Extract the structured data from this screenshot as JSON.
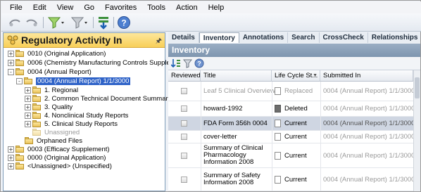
{
  "menu": [
    "File",
    "Edit",
    "View",
    "Go",
    "Favorites",
    "Tools",
    "Action",
    "Help"
  ],
  "left_panel": {
    "title": "Regulatory Activity In",
    "tree": [
      {
        "label": "0010 (Original Application)",
        "level": 0,
        "expander": "+"
      },
      {
        "label": "0006 (Chemistry Manufacturing Controls Supplement)",
        "level": 0,
        "expander": "+"
      },
      {
        "label": "0004 (Annual Report)",
        "level": 0,
        "expander": "-"
      },
      {
        "label": "0004 (Annual Report) 1/1/3000",
        "level": 1,
        "expander": "-",
        "selected": true
      },
      {
        "label": "1. Regional",
        "level": 2,
        "expander": "+"
      },
      {
        "label": "2. Common Technical Document Summaries",
        "level": 2,
        "expander": "+"
      },
      {
        "label": "3. Quality",
        "level": 2,
        "expander": "+"
      },
      {
        "label": "4. Nonclinical Study Reports",
        "level": 2,
        "expander": "+"
      },
      {
        "label": "5. Clinical Study Reports",
        "level": 2,
        "expander": "+"
      },
      {
        "label": "Unassigned",
        "level": 2,
        "expander": "",
        "muted": true
      },
      {
        "label": "Orphaned Files",
        "level": 1,
        "expander": ""
      },
      {
        "label": "0003 (Efficacy Supplement)",
        "level": 0,
        "expander": "+"
      },
      {
        "label": "0000 (Original Application)",
        "level": 0,
        "expander": "+"
      },
      {
        "label": "<Unassigned> (Unspecified)",
        "level": 0,
        "expander": "+"
      }
    ]
  },
  "tabs": [
    "Details",
    "Inventory",
    "Annotations",
    "Search",
    "CrossCheck",
    "Relationships"
  ],
  "active_tab": "Inventory",
  "inventory": {
    "title": "Inventory",
    "columns": [
      "Reviewed",
      "Title",
      "Life Cycle St...",
      "Submitted In"
    ],
    "rows": [
      {
        "title": "Leaf 5 Clinical Overview",
        "status": "Replaced",
        "submitted": "0004 (Annual Report) 1/1/3000",
        "muted": true
      },
      {
        "title": "howard-1992",
        "status": "Deleted",
        "submitted": "0004 (Annual Report) 1/1/3000",
        "muted": false
      },
      {
        "title": "FDA Form 356h 0004",
        "status": "Current",
        "submitted": "0004 (Annual Report) 1/1/3000",
        "muted": false,
        "highlight": true
      },
      {
        "title": "cover-letter",
        "status": "Current",
        "submitted": "0004 (Annual Report) 1/1/3000",
        "muted": false
      },
      {
        "title": "Summary of Clinical Pharmacology Information 2008",
        "status": "Current",
        "submitted": "0004 (Annual Report) 1/1/3000",
        "muted": false
      },
      {
        "title": "Summary of Safety Information 2008",
        "status": "Current",
        "submitted": "0004 (Annual Report) 1/1/3000",
        "muted": false
      }
    ]
  },
  "colors": {
    "accent": "#2f63c8",
    "panel_header": "#f8cf58",
    "inventory_header": "#8aa0b9"
  },
  "icons": [
    "back-icon",
    "forward-icon",
    "filter-icon",
    "filter-dropdown-icon",
    "import-icon",
    "help-icon",
    "pin-icon",
    "sort-icon"
  ]
}
